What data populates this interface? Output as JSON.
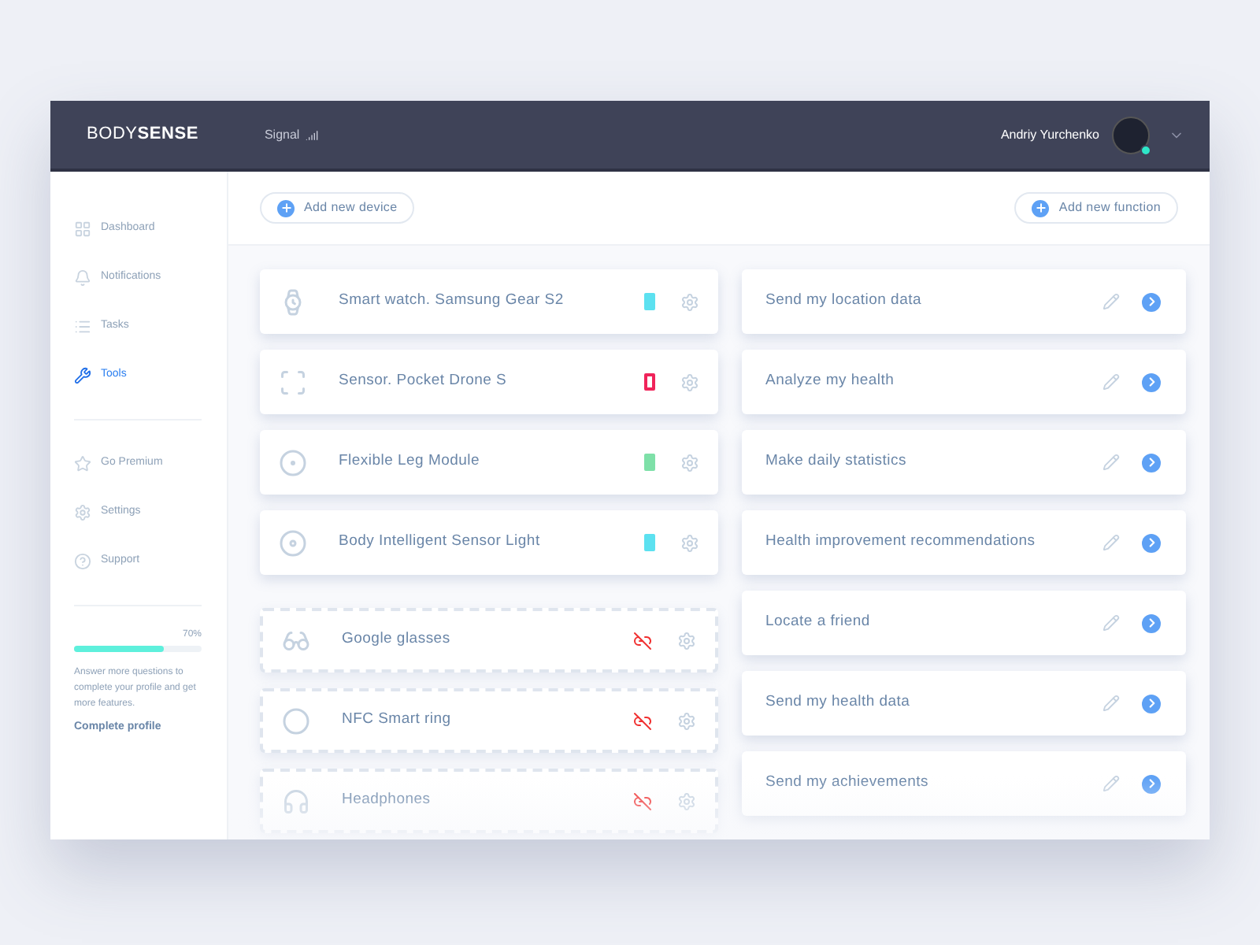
{
  "header": {
    "logo_light": "BODY",
    "logo_bold": "SENSE",
    "signal_label": "Signal",
    "user_name": "Andriy Yurchenko",
    "online": true
  },
  "sidebar": {
    "items": [
      {
        "label": "Dashboard",
        "selected": false
      },
      {
        "label": "Notifications",
        "selected": false
      },
      {
        "label": "Tasks",
        "selected": false
      },
      {
        "label": "Tools",
        "selected": true
      }
    ],
    "secondary_items": [
      {
        "label": "Go Premium"
      },
      {
        "label": "Settings"
      },
      {
        "label": "Support"
      }
    ],
    "profile": {
      "percent": "70%",
      "level": 0.7,
      "hint": "Answer more questions to complete your profile and get more features.",
      "link": "Complete profile"
    }
  },
  "toolbar": {
    "add_device": "Add new device",
    "add_function": "Add new function"
  },
  "devices": [
    {
      "name": "Smart watch. Samsung Gear S2",
      "connected": true,
      "battery_low": false,
      "color": "#5ce1f0"
    },
    {
      "name": "Sensor. Pocket Drone S",
      "connected": true,
      "battery_low": true,
      "color": "#f0245a"
    },
    {
      "name": "Flexible Leg Module",
      "connected": true,
      "battery_low": false,
      "color": "#7ee0a8"
    },
    {
      "name": "Body Intelligent Sensor Light",
      "connected": true,
      "battery_low": false,
      "color": "#5ce1f0"
    },
    {
      "name": "Google glasses",
      "connected": false
    },
    {
      "name": "NFC Smart ring",
      "connected": false
    },
    {
      "name": "Headphones",
      "connected": false
    }
  ],
  "functions": [
    {
      "name": "Send my location data"
    },
    {
      "name": "Analyze my health"
    },
    {
      "name": "Make daily statistics"
    },
    {
      "name": "Health improvement recommendations"
    },
    {
      "name": "Locate a friend"
    },
    {
      "name": "Send my health data"
    },
    {
      "name": "Send my achievements"
    }
  ]
}
